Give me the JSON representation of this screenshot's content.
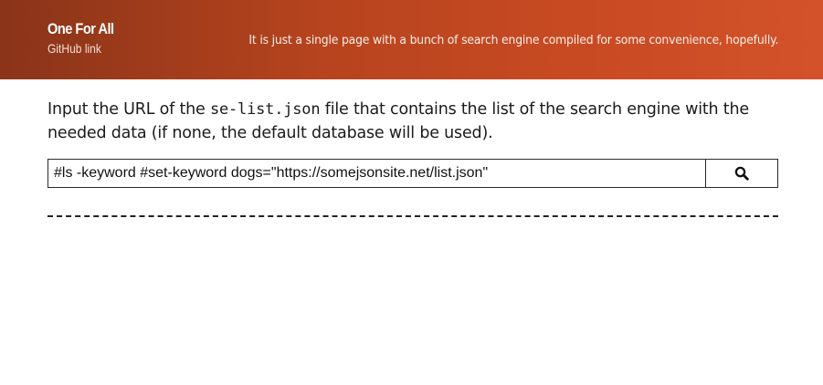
{
  "header": {
    "title": "One For All",
    "github_link": "GitHub link",
    "tagline": "It is just a single page with a bunch of search engine compiled for some convenience, hopefully.",
    "gradient_colors": [
      "#8a3419",
      "#d3522a"
    ]
  },
  "intro": {
    "prefix": "Input the URL of the ",
    "filename": "se-list.json",
    "suffix": " file that contains the list of the search engine with the needed data (if none, the default database will be used)."
  },
  "search": {
    "value": "#ls -keyword #set-keyword dogs=\"https://somejsonsite.net/list.json\"",
    "button_icon": "search-icon"
  }
}
